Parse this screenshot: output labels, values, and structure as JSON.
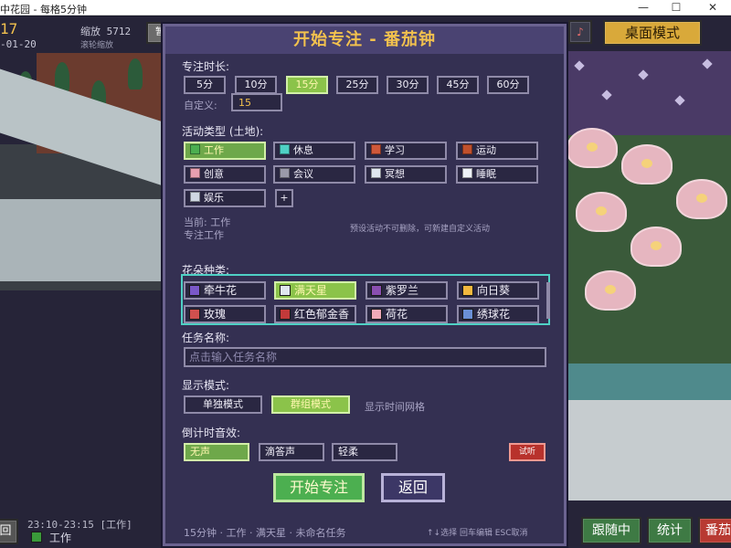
{
  "window": {
    "title": "中花园 - 每格5分钟",
    "minimize": "—",
    "maximize": "☐",
    "close": "✕"
  },
  "hud": {
    "counter": "17",
    "date": "-01-20",
    "zoom": "缩放 5712",
    "zoom_hint": "滚轮缩放",
    "mini_btn": "暂",
    "desk_mode": "桌面模式",
    "music_icon": "♪"
  },
  "bottom": {
    "back_btn": "回",
    "time_range": "23:10-23:15 [工作]",
    "task": "工作",
    "follow": "跟随中",
    "stats": "统计",
    "red_btn": "番茄"
  },
  "dialog": {
    "title": "开始专注 - 番茄钟",
    "duration_label": "专注时长:",
    "durations": [
      "5分",
      "10分",
      "15分",
      "25分",
      "30分",
      "45分",
      "60分"
    ],
    "selected_duration": 2,
    "custom_label": "自定义:",
    "custom_value": "15",
    "activity_label": "活动类型 (土地):",
    "activities": [
      {
        "label": "工作",
        "color": "#4caf50"
      },
      {
        "label": "休息",
        "color": "#4fd1c5"
      },
      {
        "label": "学习",
        "color": "#d0583a"
      },
      {
        "label": "运动",
        "color": "#c0502c"
      },
      {
        "label": "创意",
        "color": "#e8a0b0"
      },
      {
        "label": "会议",
        "color": "#9a9aaa"
      },
      {
        "label": "冥想",
        "color": "#dfe6ef"
      },
      {
        "label": "睡眠",
        "color": "#eef2f7"
      },
      {
        "label": "娱乐",
        "color": "#cfd8e2"
      }
    ],
    "selected_activity": 0,
    "add_activity": "+",
    "current_label": "当前: 工作",
    "current_sub": "专注工作",
    "preset_note": "预设活动不可删除，可新建自定义活动",
    "flower_label": "花朵种类:",
    "flowers": [
      {
        "label": "牵牛花",
        "color": "#7a58c8"
      },
      {
        "label": "满天星",
        "color": "#dfe6ef"
      },
      {
        "label": "紫罗兰",
        "color": "#8a4fb0"
      },
      {
        "label": "向日葵",
        "color": "#f2b83e"
      },
      {
        "label": "玫瑰",
        "color": "#d0504e"
      },
      {
        "label": "红色郁金香",
        "color": "#c23a3a"
      },
      {
        "label": "荷花",
        "color": "#efa9b8"
      },
      {
        "label": "绣球花",
        "color": "#6a8fd6"
      }
    ],
    "selected_flower": 1,
    "task_label": "任务名称:",
    "task_placeholder": "点击输入任务名称",
    "display_label": "显示模式:",
    "display_modes": [
      "单独模式",
      "群组模式"
    ],
    "selected_display": 1,
    "grid_hint": "显示时间网格",
    "sound_label": "倒计时音效:",
    "sounds": [
      "无声",
      "滴答声",
      "轻柔"
    ],
    "selected_sound": 0,
    "test_btn": "试听",
    "start_btn": "开始专注",
    "back_btn": "返回",
    "summary": "15分钟 · 工作 · 满天星 · 未命名任务",
    "shortcuts": "↑↓选择  回车编辑  ESC取消"
  },
  "colors": {
    "accent_gold": "#f2c14e",
    "selected_green": "#8bc34a",
    "dialog_bg": "#343052",
    "flower_border": "#4fd1c5"
  }
}
